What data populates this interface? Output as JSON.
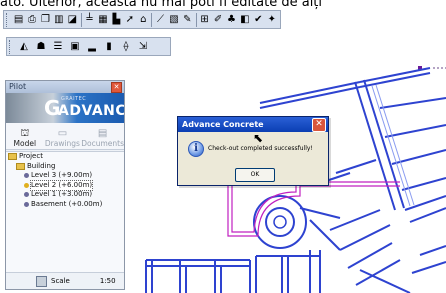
{
  "caption_fragment": "ato. Ulterior, aceasta nu mai poti fi editate de alți",
  "toolbar_top": {
    "buttons": [
      {
        "name": "properties-icon",
        "glyph": "▤"
      },
      {
        "name": "print-icon",
        "glyph": "⎙"
      },
      {
        "name": "copy-icon",
        "glyph": "❐"
      },
      {
        "name": "wall-icon",
        "glyph": "▥"
      },
      {
        "name": "slab-icon",
        "glyph": "◪"
      },
      {
        "name": "beam-icon",
        "glyph": "╧"
      },
      {
        "name": "window-icon",
        "glyph": "▦"
      },
      {
        "name": "stair-icon",
        "glyph": "▙"
      },
      {
        "name": "arrow-icon",
        "glyph": "➚"
      },
      {
        "name": "roof-icon",
        "glyph": "⌂"
      },
      {
        "name": "measure-icon",
        "glyph": "⟋"
      },
      {
        "name": "pattern-icon",
        "glyph": "▧"
      },
      {
        "name": "edit-icon",
        "glyph": "✎"
      },
      {
        "name": "grid-icon",
        "glyph": "⊞"
      },
      {
        "name": "brush-icon",
        "glyph": "✐"
      },
      {
        "name": "tree-icon",
        "glyph": "♣"
      },
      {
        "name": "layers-icon",
        "glyph": "◧"
      },
      {
        "name": "checkmark-icon",
        "glyph": "✔"
      },
      {
        "name": "tools-icon",
        "glyph": "✦"
      }
    ]
  },
  "toolbar_second": {
    "buttons": [
      {
        "name": "level-icon",
        "glyph": "◭"
      },
      {
        "name": "people-icon",
        "glyph": "☗"
      },
      {
        "name": "ladder-icon",
        "glyph": "☰"
      },
      {
        "name": "stack-icon",
        "glyph": "▣"
      },
      {
        "name": "platform-icon",
        "glyph": "▂"
      },
      {
        "name": "column-icon",
        "glyph": "▮"
      },
      {
        "name": "connect-icon",
        "glyph": "⟠"
      },
      {
        "name": "export-icon",
        "glyph": "⇲"
      }
    ]
  },
  "pilot": {
    "title": "Pilot",
    "logo_sub": "GRAITEC",
    "logo_word": "ADVANCE",
    "tabs": [
      {
        "label": "Model",
        "icon": "⛫",
        "active": true
      },
      {
        "label": "Drawings",
        "icon": "▭",
        "active": false
      },
      {
        "label": "Documents",
        "icon": "▤",
        "active": false
      }
    ],
    "tree": [
      {
        "label": "Project",
        "type": "folder",
        "indent": 0
      },
      {
        "label": "Building",
        "type": "folder",
        "indent": 1
      },
      {
        "label": "Level 3 (+9.00m)",
        "type": "dot",
        "color": "#6a6a9a",
        "indent": 2
      },
      {
        "label": "Level 2 (+6.00m)",
        "type": "dot",
        "color": "#e0b020",
        "indent": 2,
        "selected": true
      },
      {
        "label": "Level 1 (+3.00m)",
        "type": "dot",
        "color": "#6a6a9a",
        "indent": 2
      },
      {
        "label": "Basement (+0.00m)",
        "type": "dot",
        "color": "#6a6a9a",
        "indent": 2
      }
    ],
    "scale_label": "Scale",
    "scale_value": "1:50"
  },
  "dialog": {
    "title": "Advance Concrete",
    "message": "Check-out completed successfully!",
    "ok_label": "OK"
  }
}
